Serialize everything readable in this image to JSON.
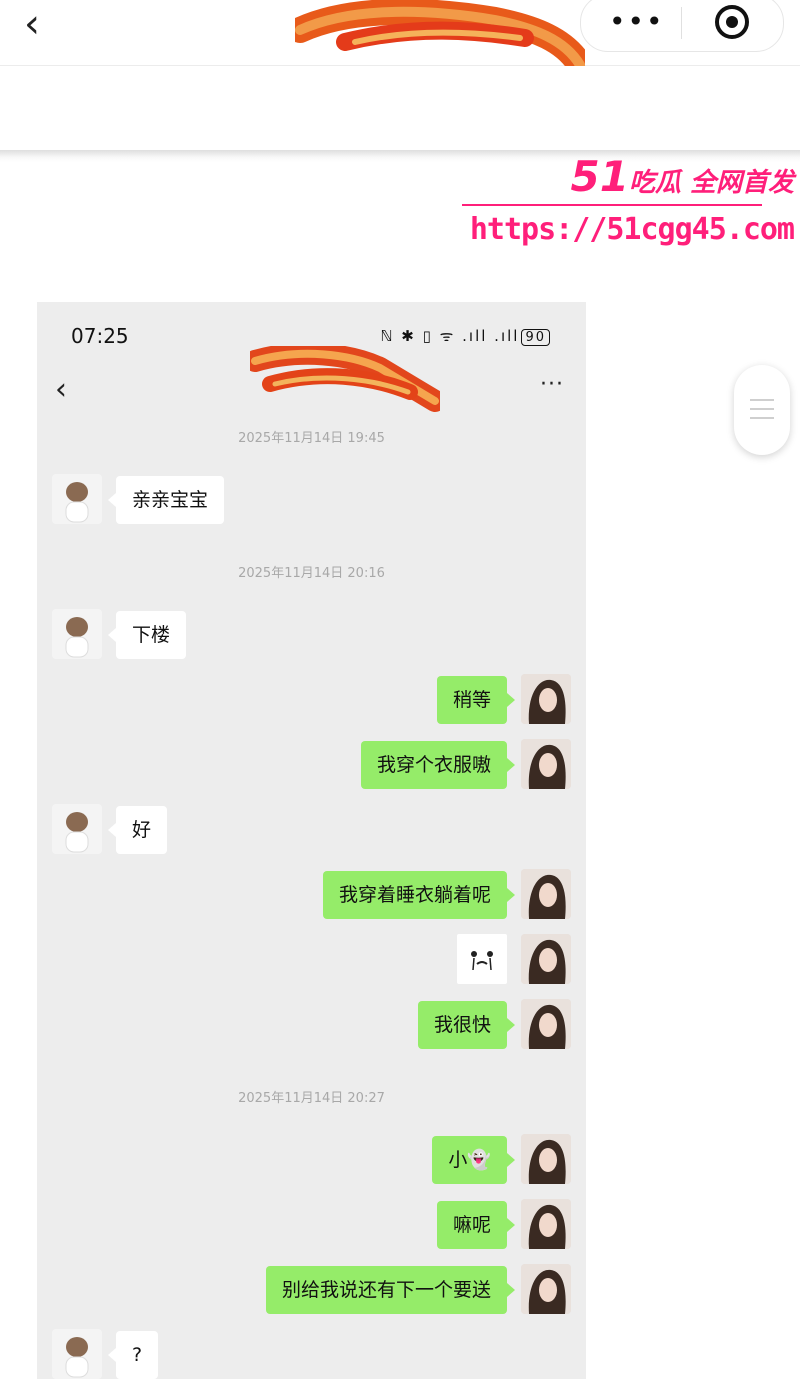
{
  "header": {
    "back_icon": "chevron-left-icon",
    "menu_icon": "more-dots-icon",
    "target_icon": "record-icon"
  },
  "watermark": {
    "prefix": "51",
    "tagline": "吃瓜 全网首发",
    "url": "https://51cgg45.com"
  },
  "colors": {
    "bubble_out": "#95ec69",
    "bubble_in": "#ffffff",
    "chat_bg": "#ededed",
    "watermark": "#ff1f7a"
  },
  "phone": {
    "status": {
      "time": "07:25",
      "icons": "ℕ ✱ ▯ ᯤ .ıll .ıll",
      "battery": "90"
    },
    "nav": {
      "back": "‹",
      "more": "···"
    },
    "timestamps": [
      "2025年11月14日 19:45",
      "2025年11月14日 20:16",
      "2025年11月14日 20:27"
    ],
    "messages": [
      {
        "side": "in",
        "text": "亲亲宝宝"
      },
      {
        "side": "in",
        "text": "下楼"
      },
      {
        "side": "out",
        "text": "稍等"
      },
      {
        "side": "out",
        "text": "我穿个衣服嗷"
      },
      {
        "side": "in",
        "text": "好"
      },
      {
        "side": "out",
        "text": "我穿着睡衣躺着呢"
      },
      {
        "side": "out",
        "text": "",
        "sticker": "crying-face-sticker"
      },
      {
        "side": "out",
        "text": "我很快"
      },
      {
        "side": "out",
        "text": "小👻"
      },
      {
        "side": "out",
        "text": "嘛呢"
      },
      {
        "side": "out",
        "text": "别给我说还有下一个要送"
      },
      {
        "side": "in",
        "text": "?"
      }
    ]
  }
}
